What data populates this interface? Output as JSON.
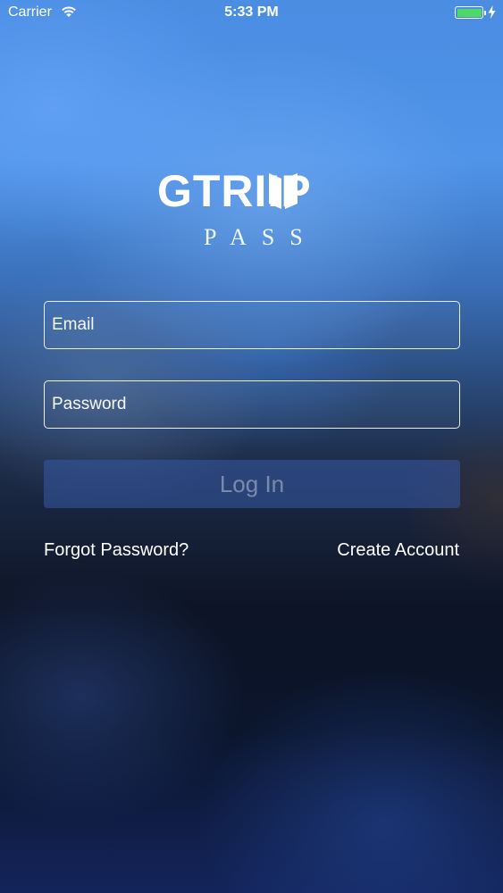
{
  "status_bar": {
    "carrier": "Carrier",
    "time": "5:33 PM",
    "battery_level": 1.0,
    "battery_color": "#4cd964"
  },
  "logo": {
    "text": "GTRIIP",
    "subtitle": "PASS"
  },
  "form": {
    "email_placeholder": "Email",
    "password_placeholder": "Password",
    "login_label": "Log In",
    "forgot_password": "Forgot Password?",
    "create_account": "Create Account"
  },
  "colors": {
    "accent_button": "#375aa5"
  }
}
